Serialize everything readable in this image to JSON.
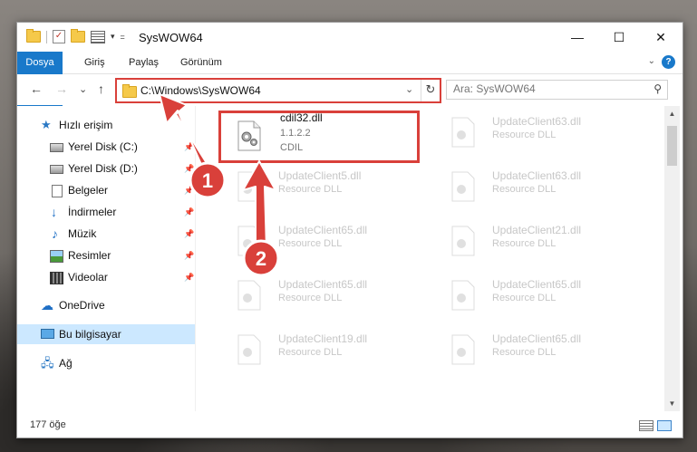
{
  "window": {
    "title": "SysWOW64",
    "controls": {
      "minimize": "—",
      "maximize": "☐",
      "close": "✕"
    }
  },
  "quick_access": {
    "dropdown_glyph": "▾",
    "customize_glyph": "="
  },
  "ribbon": {
    "tabs": [
      "Dosya",
      "Giriş",
      "Paylaş",
      "Görünüm"
    ],
    "collapse_glyph": "⌄",
    "help_glyph": "?"
  },
  "address": {
    "back": "←",
    "forward": "→",
    "recent": "⌄",
    "up": "↑",
    "path": "C:\\Windows\\SysWOW64",
    "dropdown": "⌄",
    "refresh": "↻"
  },
  "search": {
    "placeholder": "Ara: SysWOW64",
    "icon": "search-icon"
  },
  "nav": {
    "items": [
      {
        "label": "Hızlı erişim",
        "icon": "star-icon",
        "pinned": false
      },
      {
        "label": "Yerel Disk (C:)",
        "icon": "disk-icon",
        "pinned": true
      },
      {
        "label": "Yerel Disk (D:)",
        "icon": "disk-icon",
        "pinned": true
      },
      {
        "label": "Belgeler",
        "icon": "documents-icon",
        "pinned": true
      },
      {
        "label": "İndirmeler",
        "icon": "downloads-icon",
        "pinned": true
      },
      {
        "label": "Müzik",
        "icon": "music-icon",
        "pinned": true
      },
      {
        "label": "Resimler",
        "icon": "pictures-icon",
        "pinned": true
      },
      {
        "label": "Videolar",
        "icon": "videos-icon",
        "pinned": true
      },
      {
        "label": "OneDrive",
        "icon": "cloud-icon",
        "pinned": false
      },
      {
        "label": "Bu bilgisayar",
        "icon": "computer-icon",
        "pinned": false,
        "selected": true
      },
      {
        "label": "Ağ",
        "icon": "network-icon",
        "pinned": false
      }
    ],
    "pin_glyph": "📌"
  },
  "files": {
    "main": {
      "name": "cdil32.dll",
      "version": "1.1.2.2",
      "desc": "CDIL"
    },
    "faded": [
      {
        "name": "UpdateClient63.dll",
        "desc": "Resource DLL"
      },
      {
        "name": "UpdateClient5.dll",
        "desc": "Resource DLL"
      },
      {
        "name": "UpdateClient63.dll",
        "desc": "Resource DLL"
      },
      {
        "name": "UpdateClient65.dll",
        "desc": "Resource DLL"
      },
      {
        "name": "UpdateClient21.dll",
        "desc": "Resource DLL"
      },
      {
        "name": "UpdateClient65.dll",
        "desc": "Resource DLL"
      },
      {
        "name": "UpdateClient65.dll",
        "desc": "Resource DLL"
      },
      {
        "name": "UpdateClient19.dll",
        "desc": "Resource DLL"
      },
      {
        "name": "UpdateClient65.dll",
        "desc": "Resource DLL"
      }
    ]
  },
  "scrollbar": {
    "up": "▲",
    "down": "▼"
  },
  "status": {
    "count": "177 öğe"
  },
  "annotations": {
    "badge1": "1",
    "badge2": "2",
    "color": "#d9403a"
  }
}
